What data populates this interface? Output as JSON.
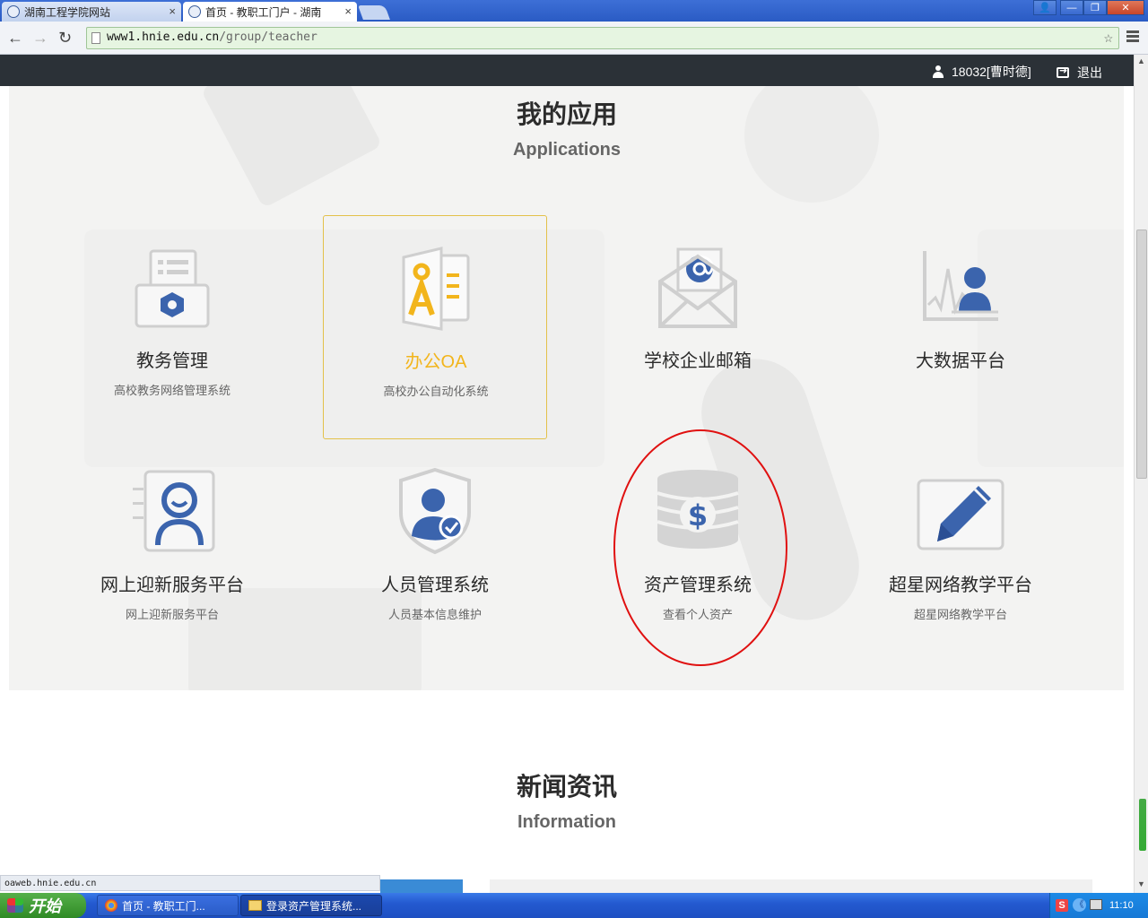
{
  "browser": {
    "tabs": [
      {
        "title": "湖南工程学院网站",
        "close": "×"
      },
      {
        "title": "首页 - 教职工门户 - 湖南",
        "close": "×"
      }
    ],
    "window_buttons": {
      "user": "👤",
      "minimize": "—",
      "restore": "❐",
      "close": "✕"
    },
    "nav": {
      "back": "←",
      "forward": "→",
      "reload": "↻"
    },
    "url_host": "www1.hnie.edu.cn",
    "url_path": "/group/teacher",
    "star": "☆",
    "status_url": "oaweb.hnie.edu.cn"
  },
  "header": {
    "username": "18032[曹时德]",
    "logout_label": "退出"
  },
  "applications": {
    "title": "我的应用",
    "subtitle": "Applications",
    "items": [
      {
        "name": "教务管理",
        "desc": "高校教务网络管理系统",
        "icon": "document-gear-icon"
      },
      {
        "name": "办公OA",
        "desc": "高校办公自动化系统",
        "icon": "oa-document-icon",
        "active": true
      },
      {
        "name": "学校企业邮箱",
        "desc": "",
        "icon": "email-envelope-icon"
      },
      {
        "name": "大数据平台",
        "desc": "",
        "icon": "chart-user-icon"
      },
      {
        "name": "网上迎新服务平台",
        "desc": "网上迎新服务平台",
        "icon": "welcome-person-icon"
      },
      {
        "name": "人员管理系统",
        "desc": "人员基本信息维护",
        "icon": "shield-user-icon"
      },
      {
        "name": "资产管理系统",
        "desc": "查看个人资产",
        "icon": "coin-stack-dollar-icon"
      },
      {
        "name": "超星网络教学平台",
        "desc": "超星网络教学平台",
        "icon": "pencil-edit-icon"
      }
    ]
  },
  "news": {
    "title": "新闻资讯",
    "subtitle": "Information"
  },
  "taskbar": {
    "start_label": "开始",
    "tasks": [
      {
        "label": "首页 - 教职工门..."
      },
      {
        "label": "登录资产管理系统..."
      }
    ],
    "tray_ime": "S",
    "tray_arrow": "《",
    "clock": "11:10"
  },
  "colors": {
    "header_bar": "#2b3137",
    "active_app": "#f2b51c",
    "icon_blue": "#3b64ad",
    "annotation_circle": "#e01010"
  }
}
